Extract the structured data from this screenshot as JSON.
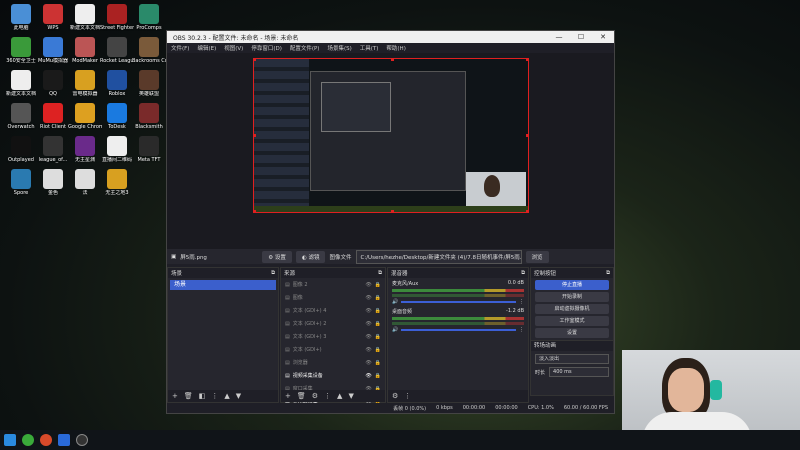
{
  "desktop": {
    "icons": [
      {
        "label": "此电脑",
        "color": "#4a8fd6"
      },
      {
        "label": "WPS",
        "color": "#c33"
      },
      {
        "label": "新建文本文档",
        "color": "#eee"
      },
      {
        "label": "Street Fighter 6",
        "color": "#a22"
      },
      {
        "label": "ProComps",
        "color": "#2a8a6a"
      },
      {
        "label": "360安全卫士",
        "color": "#3a9a3a"
      },
      {
        "label": "MuMu模拟器",
        "color": "#3a7ad6"
      },
      {
        "label": "ModMaker",
        "color": "#b55"
      },
      {
        "label": "Rocket League",
        "color": "#444"
      },
      {
        "label": "Backrooms Company",
        "color": "#7a5a3a"
      },
      {
        "label": "新建文本文档",
        "color": "#eee"
      },
      {
        "label": "QQ",
        "color": "#1a1a1a"
      },
      {
        "label": "雷电模拟器",
        "color": "#d8a020"
      },
      {
        "label": "Roblox",
        "color": "#2050a0"
      },
      {
        "label": "英雄联盟",
        "color": "#5a3a2a"
      },
      {
        "label": "Overwatch",
        "color": "#555"
      },
      {
        "label": "Riot Client",
        "color": "#d22"
      },
      {
        "label": "Google Chrome",
        "color": "#dda020"
      },
      {
        "label": "ToDesk",
        "color": "#1a7ae0"
      },
      {
        "label": "Blacksmith",
        "color": "#7a2a2a"
      },
      {
        "label": "Outplayed",
        "color": "#111"
      },
      {
        "label": "league_of...",
        "color": "#333"
      },
      {
        "label": "无主星渊",
        "color": "#6a2a8a"
      },
      {
        "label": "直播间二维码",
        "color": "#eee"
      },
      {
        "label": "Meta TFT",
        "color": "#2a2a2a"
      },
      {
        "label": "Spore",
        "color": "#2a7ab0"
      },
      {
        "label": "金色",
        "color": "#ddd"
      },
      {
        "label": "法",
        "color": "#ddd"
      },
      {
        "label": "无主之地3",
        "color": "#d8a020"
      }
    ]
  },
  "window": {
    "title": "OBS 30.2.3 - 配置文件: 未命名 - 场景: 未命名",
    "minimize": "—",
    "maximize": "☐",
    "close": "✕"
  },
  "menu": [
    "文件(F)",
    "编辑(E)",
    "视图(V)",
    "停靠窗口(D)",
    "配置文件(P)",
    "场景集(S)",
    "工具(T)",
    "帮助(H)"
  ],
  "source_bar": {
    "source_name": "屏5雨.png",
    "properties": "设置",
    "filters": "滤镜",
    "image_file_label": "图像文件",
    "path": "C:/Users/hezhe/Desktop/新建文件夹 (4)/7.8日随机事件/屏5雨.png",
    "browse": "浏览"
  },
  "scenes": {
    "title": "场景",
    "items": [
      "场景"
    ]
  },
  "sources": {
    "title": "来源",
    "items": [
      {
        "name": "图像 2",
        "active": false
      },
      {
        "name": "图像",
        "active": false
      },
      {
        "name": "文本 (GDI+) 4",
        "active": false
      },
      {
        "name": "文本 (GDI+) 2",
        "active": false
      },
      {
        "name": "文本 (GDI+) 3",
        "active": false
      },
      {
        "name": "文本 (GDI+)",
        "active": false
      },
      {
        "name": "浏览器",
        "active": false
      },
      {
        "name": "视频采集设备",
        "active": true
      },
      {
        "name": "窗口采集",
        "active": false
      },
      {
        "name": "显示器采集",
        "active": true
      }
    ]
  },
  "mixer": {
    "title": "混音器",
    "channels": [
      {
        "name": "麦克风/Aux",
        "db": "0.0 dB"
      },
      {
        "name": "桌面音频",
        "db": "-1.2 dB"
      }
    ]
  },
  "controls": {
    "title": "控制按钮",
    "buttons": [
      {
        "label": "停止直播",
        "primary": true
      },
      {
        "label": "开始录制",
        "primary": false
      },
      {
        "label": "启动虚拟摄像机",
        "primary": false
      },
      {
        "label": "工作室模式",
        "primary": false
      },
      {
        "label": "设置",
        "primary": false
      },
      {
        "label": "退出",
        "primary": false
      }
    ]
  },
  "transitions": {
    "title": "转场动画",
    "type": "淡入淡出",
    "duration_label": "时长",
    "duration": "400 ms"
  },
  "status": {
    "dropped": "丢帧 0 (0.0%)",
    "bitrate": "0 kbps",
    "live_time": "00:00:00",
    "rec_time": "00:00:00",
    "cpu": "CPU: 1.0%",
    "fps": "60.00 / 60.00 FPS"
  },
  "colors": {
    "accent": "#3b5fcc",
    "selection_border": "#e02020",
    "bg": "#1f1f27"
  }
}
